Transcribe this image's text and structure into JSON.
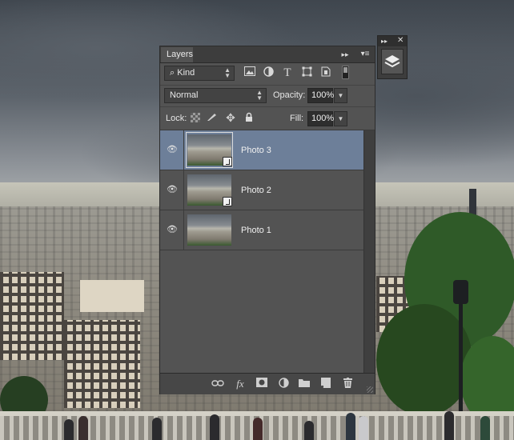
{
  "panel": {
    "tab_label": "Layers",
    "collapse_icon": "double-chevron-right-icon",
    "menu_icon": "panel-menu-icon"
  },
  "filter": {
    "search_icon": "search-icon",
    "kind_label": "Kind",
    "icons": [
      "pixel-filter-icon",
      "adjustment-filter-icon",
      "type-filter-icon",
      "shape-filter-icon",
      "smart-object-filter-icon"
    ]
  },
  "blend": {
    "mode": "Normal",
    "opacity_label": "Opacity:",
    "opacity_value": "100%"
  },
  "lock": {
    "label": "Lock:",
    "fill_label": "Fill:",
    "fill_value": "100%"
  },
  "layers": [
    {
      "name": "Photo 3",
      "selected": true,
      "smart_object": true
    },
    {
      "name": "Photo 2",
      "selected": false,
      "smart_object": true
    },
    {
      "name": "Photo 1",
      "selected": false,
      "smart_object": false
    }
  ],
  "footer": {
    "icons": [
      "link-layers-icon",
      "fx-icon",
      "add-mask-icon",
      "adjustment-layer-icon",
      "new-group-icon",
      "new-layer-icon",
      "delete-layer-icon"
    ],
    "fx_label": "fx"
  },
  "mini_panel": {
    "collapse_icon": "double-chevron-right-icon",
    "close_icon": "close-icon",
    "layers_icon": "layers-icon"
  },
  "colors": {
    "panel_bg": "#535353",
    "selected_layer": "#6d7f99",
    "tab_bar": "#3d3d3d"
  }
}
